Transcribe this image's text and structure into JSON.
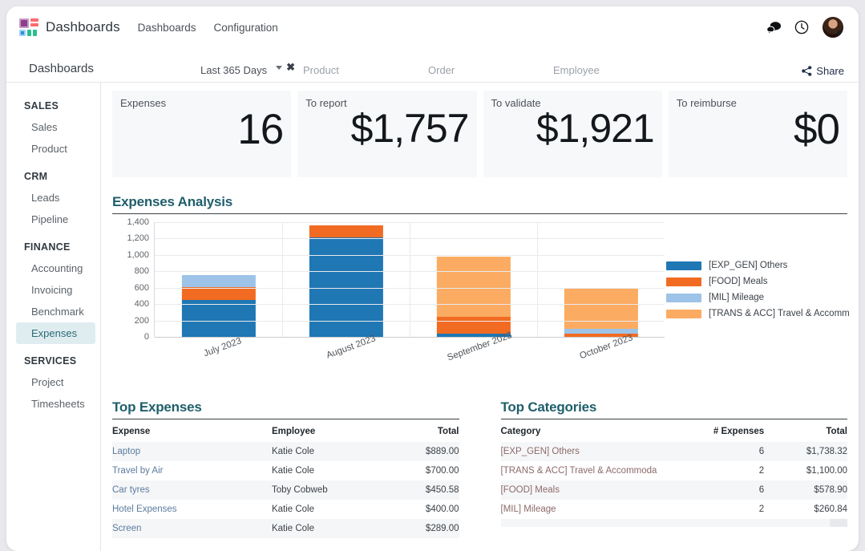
{
  "app": {
    "brand": "Dashboards",
    "nav": [
      "Dashboards",
      "Configuration"
    ],
    "view_title": "Dashboards"
  },
  "topbar_icons": {
    "messages": "chat-bubbles-icon",
    "activities": "clock-icon",
    "avatar": "user-avatar"
  },
  "searchbar": {
    "date_filter": "Last 365 Days",
    "product_placeholder": "Product",
    "order_placeholder": "Order",
    "employee_placeholder": "Employee",
    "share_label": "Share"
  },
  "sidebar": {
    "groups": [
      {
        "label": "SALES",
        "items": [
          {
            "label": "Sales",
            "active": false
          },
          {
            "label": "Product",
            "active": false
          }
        ]
      },
      {
        "label": "CRM",
        "items": [
          {
            "label": "Leads",
            "active": false
          },
          {
            "label": "Pipeline",
            "active": false
          }
        ]
      },
      {
        "label": "FINANCE",
        "items": [
          {
            "label": "Accounting",
            "active": false
          },
          {
            "label": "Invoicing",
            "active": false
          },
          {
            "label": "Benchmark",
            "active": false
          },
          {
            "label": "Expenses",
            "active": true
          }
        ]
      },
      {
        "label": "SERVICES",
        "items": [
          {
            "label": "Project",
            "active": false
          },
          {
            "label": "Timesheets",
            "active": false
          }
        ]
      }
    ]
  },
  "kpis": [
    {
      "label": "Expenses",
      "value": "16"
    },
    {
      "label": "To report",
      "value": "$1,757"
    },
    {
      "label": "To validate",
      "value": "$1,921"
    },
    {
      "label": "To reimburse",
      "value": "$0"
    }
  ],
  "sections": {
    "chart_title": "Expenses Analysis",
    "top_expenses_title": "Top Expenses",
    "top_categories_title": "Top Categories"
  },
  "chart_data": {
    "type": "bar",
    "stacked": true,
    "title": "Expenses Analysis",
    "xlabel": "",
    "ylabel": "",
    "ylim": [
      0,
      1400
    ],
    "yticks": [
      0,
      200,
      400,
      600,
      800,
      1000,
      1200,
      1400
    ],
    "ytick_labels": [
      "0",
      "200",
      "400",
      "600",
      "800",
      "1,000",
      "1,200",
      "1,400"
    ],
    "grid": true,
    "legend_position": "right",
    "categories": [
      "July 2023",
      "August 2023",
      "September 2023",
      "October 2023"
    ],
    "series": [
      {
        "name": "[EXP_GEN] Others",
        "color": "#1f77b4",
        "values": [
          450,
          1210,
          42,
          0
        ]
      },
      {
        "name": "[FOOD] Meals",
        "color": "#f26b22",
        "values": [
          155,
          150,
          200,
          35
        ]
      },
      {
        "name": "[MIL] Mileage",
        "color": "#9dc3e8",
        "values": [
          152,
          0,
          0,
          65
        ]
      },
      {
        "name": "[TRANS & ACC] Travel & Accomm",
        "color": "#fbab62",
        "values": [
          0,
          0,
          735,
          500
        ]
      }
    ]
  },
  "top_expenses": {
    "columns": [
      "Expense",
      "Employee",
      "Total"
    ],
    "rows": [
      {
        "expense": "Laptop",
        "employee": "Katie Cole",
        "total": "$889.00"
      },
      {
        "expense": "Travel by Air",
        "employee": "Katie Cole",
        "total": "$700.00"
      },
      {
        "expense": "Car tyres",
        "employee": "Toby Cobweb",
        "total": "$450.58"
      },
      {
        "expense": "Hotel Expenses",
        "employee": "Katie Cole",
        "total": "$400.00"
      },
      {
        "expense": "Screen",
        "employee": "Katie Cole",
        "total": "$289.00"
      }
    ]
  },
  "top_categories": {
    "columns": [
      "Category",
      "# Expenses",
      "Total"
    ],
    "rows": [
      {
        "category": "[EXP_GEN] Others",
        "count": "6",
        "total": "$1,738.32"
      },
      {
        "category": "[TRANS & ACC] Travel & Accommoda",
        "count": "2",
        "total": "$1,100.00"
      },
      {
        "category": "[FOOD] Meals",
        "count": "6",
        "total": "$578.90"
      },
      {
        "category": "[MIL] Mileage",
        "count": "2",
        "total": "$260.84"
      }
    ]
  },
  "colors": {
    "accent_teal": "#1f5f6b",
    "active_bg": "#e0edf0",
    "card_bg": "#f7f8fa"
  }
}
